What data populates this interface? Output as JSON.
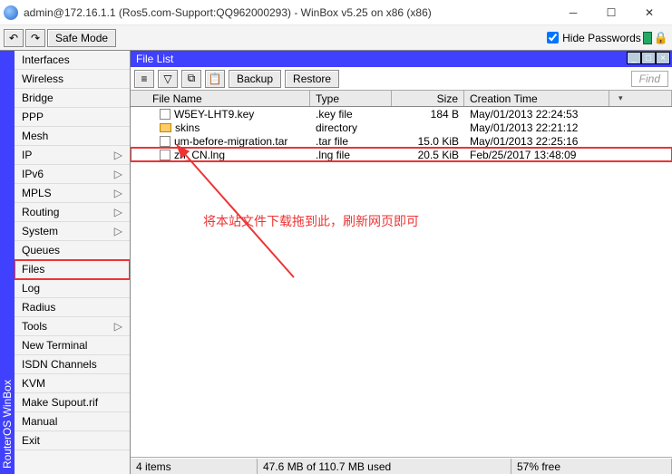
{
  "window": {
    "title": "admin@172.16.1.1 (Ros5.com-Support:QQ962000293) - WinBox v5.25 on x86 (x86)"
  },
  "toolbar": {
    "safe_mode": "Safe Mode",
    "hide_passwords": "Hide Passwords"
  },
  "vtab": "RouterOS WinBox",
  "sidebar": {
    "items": [
      {
        "label": "Interfaces",
        "chev": false
      },
      {
        "label": "Wireless",
        "chev": false
      },
      {
        "label": "Bridge",
        "chev": false
      },
      {
        "label": "PPP",
        "chev": false
      },
      {
        "label": "Mesh",
        "chev": false
      },
      {
        "label": "IP",
        "chev": true
      },
      {
        "label": "IPv6",
        "chev": true
      },
      {
        "label": "MPLS",
        "chev": true
      },
      {
        "label": "Routing",
        "chev": true
      },
      {
        "label": "System",
        "chev": true
      },
      {
        "label": "Queues",
        "chev": false
      },
      {
        "label": "Files",
        "chev": false,
        "highlight": true
      },
      {
        "label": "Log",
        "chev": false
      },
      {
        "label": "Radius",
        "chev": false
      },
      {
        "label": "Tools",
        "chev": true
      },
      {
        "label": "New Terminal",
        "chev": false
      },
      {
        "label": "ISDN Channels",
        "chev": false
      },
      {
        "label": "KVM",
        "chev": false
      },
      {
        "label": "Make Supout.rif",
        "chev": false
      },
      {
        "label": "Manual",
        "chev": false
      },
      {
        "label": "Exit",
        "chev": false
      }
    ]
  },
  "panel": {
    "title": "File List",
    "backup": "Backup",
    "restore": "Restore",
    "find": "Find",
    "columns": {
      "name": "File Name",
      "type": "Type",
      "size": "Size",
      "ctime": "Creation Time"
    },
    "rows": [
      {
        "icon": "file",
        "name": "W5EY-LHT9.key",
        "type": ".key file",
        "size": "184 B",
        "ctime": "May/01/2013 22:24:53"
      },
      {
        "icon": "folder",
        "name": "skins",
        "type": "directory",
        "size": "",
        "ctime": "May/01/2013 22:21:12"
      },
      {
        "icon": "file",
        "name": "um-before-migration.tar",
        "type": ".tar file",
        "size": "15.0 KiB",
        "ctime": "May/01/2013 22:25:16"
      },
      {
        "icon": "file",
        "name": "zh_CN.lng",
        "type": ".lng file",
        "size": "20.5 KiB",
        "ctime": "Feb/25/2017 13:48:09",
        "highlight": true
      }
    ],
    "annotation": "将本站文件下载拖到此，刷新网页即可",
    "status": {
      "count": "4 items",
      "used": "47.6 MB of 110.7 MB used",
      "free": "57% free"
    }
  }
}
